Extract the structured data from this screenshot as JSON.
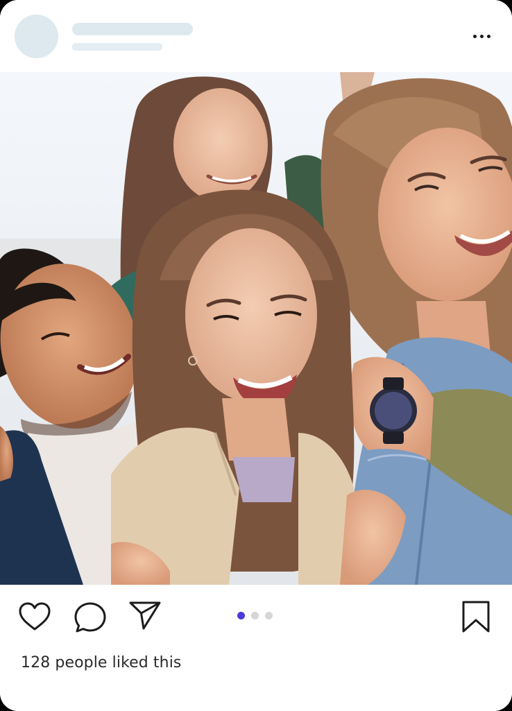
{
  "post": {
    "header": {
      "avatar_icon": "avatar-placeholder",
      "more_icon": "more-horizontal-icon"
    },
    "image": {
      "description_icon": "group-selfie-photo"
    },
    "actions": {
      "like_icon": "heart-icon",
      "comment_icon": "comment-bubble-icon",
      "share_icon": "send-plane-icon",
      "save_icon": "bookmark-icon"
    },
    "pagination": {
      "count": 3,
      "active_index": 0,
      "active_color": "#4b39d8",
      "inactive_color": "#d6d6d6"
    },
    "likes_text": "128 people liked this"
  },
  "colors": {
    "skeleton": "#dde9ef",
    "card_background": "#ffffff",
    "page_background": "#000000",
    "icon_stroke": "#1b1b1b"
  }
}
